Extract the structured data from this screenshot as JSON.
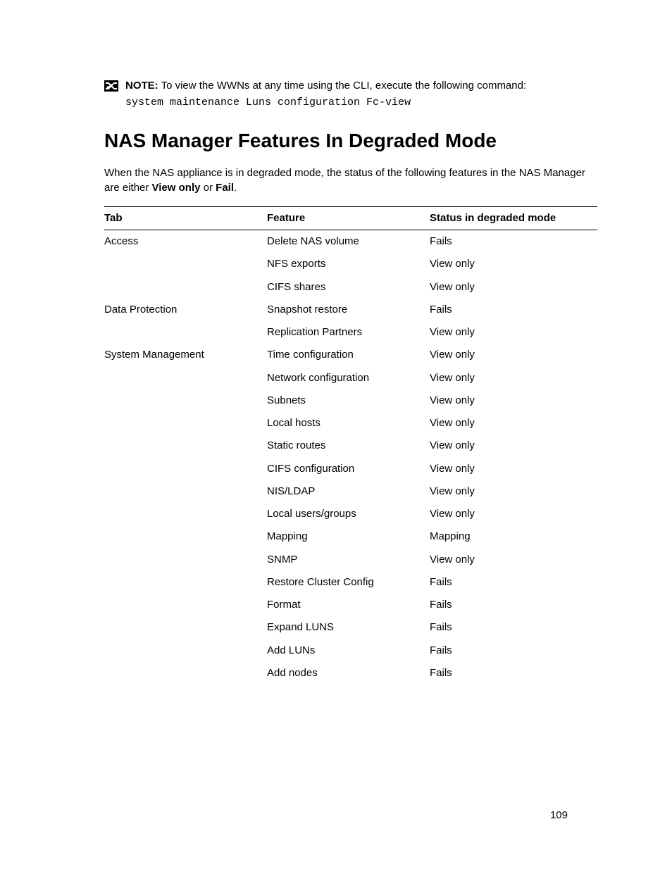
{
  "note": {
    "label": "NOTE:",
    "text": " To view the WWNs at any time using the CLI, execute the following command:",
    "command": "system maintenance Luns configuration Fc-view"
  },
  "heading": "NAS Manager Features In Degraded Mode",
  "intro": {
    "t1": "When the NAS appliance is in degraded mode, the status of the following features in the NAS Manager are either ",
    "b1": "View only",
    "t2": " or ",
    "b2": "Fail",
    "t3": "."
  },
  "table": {
    "headers": {
      "tab": "Tab",
      "feature": "Feature",
      "status": "Status in degraded mode"
    }
  },
  "chart_data": {
    "type": "table",
    "title": "NAS Manager Features In Degraded Mode",
    "columns": [
      "Tab",
      "Feature",
      "Status in degraded mode"
    ],
    "rows": [
      {
        "tab": "Access",
        "feature": "Delete NAS volume",
        "status": "Fails"
      },
      {
        "tab": "",
        "feature": "NFS exports",
        "status": "View only"
      },
      {
        "tab": "",
        "feature": "CIFS shares",
        "status": "View only"
      },
      {
        "tab": "Data Protection",
        "feature": "Snapshot restore",
        "status": "Fails"
      },
      {
        "tab": "",
        "feature": "Replication Partners",
        "status": "View only"
      },
      {
        "tab": "System Management",
        "feature": "Time configuration",
        "status": "View only"
      },
      {
        "tab": "",
        "feature": "Network configuration",
        "status": "View only"
      },
      {
        "tab": "",
        "feature": "Subnets",
        "status": "View only"
      },
      {
        "tab": "",
        "feature": "Local hosts",
        "status": "View only"
      },
      {
        "tab": "",
        "feature": "Static routes",
        "status": "View only"
      },
      {
        "tab": "",
        "feature": "CIFS configuration",
        "status": "View only"
      },
      {
        "tab": "",
        "feature": "NIS/LDAP",
        "status": "View only"
      },
      {
        "tab": "",
        "feature": "Local users/groups",
        "status": "View only"
      },
      {
        "tab": "",
        "feature": "Mapping",
        "status": "Mapping"
      },
      {
        "tab": "",
        "feature": "SNMP",
        "status": "View only"
      },
      {
        "tab": "",
        "feature": "Restore Cluster Config",
        "status": "Fails"
      },
      {
        "tab": "",
        "feature": "Format",
        "status": "Fails"
      },
      {
        "tab": "",
        "feature": "Expand LUNS",
        "status": "Fails"
      },
      {
        "tab": "",
        "feature": "Add LUNs",
        "status": "Fails"
      },
      {
        "tab": "",
        "feature": "Add nodes",
        "status": "Fails"
      }
    ]
  },
  "page_number": "109"
}
